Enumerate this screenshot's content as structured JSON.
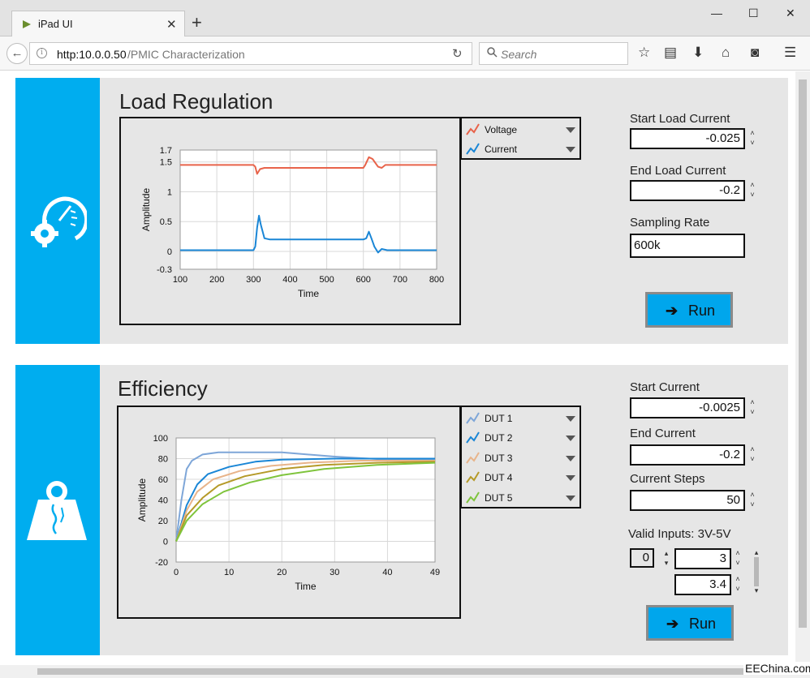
{
  "browser": {
    "tab_title": "iPad UI",
    "tab_close": "✕",
    "new_tab": "+",
    "url_host": "http:10.0.0.50",
    "url_path": "/PMIC Characterization",
    "search_placeholder": "Search"
  },
  "load_regulation": {
    "title": "Load Regulation",
    "chart_data": {
      "type": "line",
      "xlabel": "Time",
      "ylabel": "Amplitude",
      "xlim": [
        100,
        800
      ],
      "ylim": [
        -0.3,
        1.7
      ],
      "x_ticks": [
        "100",
        "200",
        "300",
        "400",
        "500",
        "600",
        "700",
        "800"
      ],
      "y_ticks": [
        "1.7",
        "1.5",
        "1",
        "0.5",
        "0",
        "-0.3"
      ],
      "grid": true,
      "series": [
        {
          "name": "Voltage",
          "color": "#e8634a",
          "points": [
            [
              100,
              1.45
            ],
            [
              300,
              1.45
            ],
            [
              305,
              1.42
            ],
            [
              310,
              1.3
            ],
            [
              318,
              1.38
            ],
            [
              330,
              1.4
            ],
            [
              450,
              1.4
            ],
            [
              600,
              1.4
            ],
            [
              605,
              1.45
            ],
            [
              615,
              1.58
            ],
            [
              625,
              1.55
            ],
            [
              640,
              1.42
            ],
            [
              650,
              1.4
            ],
            [
              660,
              1.45
            ],
            [
              800,
              1.45
            ]
          ]
        },
        {
          "name": "Current",
          "color": "#1a86d6",
          "points": [
            [
              100,
              0.02
            ],
            [
              300,
              0.02
            ],
            [
              305,
              0.08
            ],
            [
              310,
              0.4
            ],
            [
              315,
              0.6
            ],
            [
              320,
              0.45
            ],
            [
              330,
              0.22
            ],
            [
              345,
              0.2
            ],
            [
              600,
              0.2
            ],
            [
              608,
              0.22
            ],
            [
              615,
              0.33
            ],
            [
              622,
              0.22
            ],
            [
              630,
              0.08
            ],
            [
              640,
              -0.02
            ],
            [
              650,
              0.04
            ],
            [
              665,
              0.02
            ],
            [
              800,
              0.02
            ]
          ]
        }
      ]
    },
    "legend": [
      {
        "label": "Voltage",
        "color": "#e8634a"
      },
      {
        "label": "Current",
        "color": "#1a86d6"
      }
    ],
    "controls": {
      "start_label": "Start Load Current",
      "start_value": "-0.025",
      "end_label": "End Load Current",
      "end_value": "-0.2",
      "rate_label": "Sampling Rate",
      "rate_value": "600k",
      "run_label": "Run"
    }
  },
  "efficiency": {
    "title": "Efficiency",
    "chart_data": {
      "type": "line",
      "xlabel": "Time",
      "ylabel": "Amplitude",
      "xlim": [
        0,
        49
      ],
      "ylim": [
        -20,
        100
      ],
      "x_ticks": [
        "0",
        "10",
        "20",
        "30",
        "40",
        "49"
      ],
      "y_ticks": [
        "100",
        "80",
        "60",
        "40",
        "20",
        "0",
        "-20"
      ],
      "grid": true,
      "series": [
        {
          "name": "DUT 1",
          "color": "#7ea6d8",
          "points": [
            [
              0,
              0
            ],
            [
              1,
              40
            ],
            [
              2,
              70
            ],
            [
              3,
              78
            ],
            [
              5,
              84
            ],
            [
              8,
              86
            ],
            [
              12,
              86
            ],
            [
              20,
              86
            ],
            [
              30,
              82
            ],
            [
              40,
              79
            ],
            [
              49,
              79
            ]
          ]
        },
        {
          "name": "DUT 2",
          "color": "#1a86d6",
          "points": [
            [
              0,
              0
            ],
            [
              2,
              35
            ],
            [
              4,
              55
            ],
            [
              6,
              65
            ],
            [
              10,
              72
            ],
            [
              15,
              77
            ],
            [
              20,
              79
            ],
            [
              30,
              80
            ],
            [
              40,
              80
            ],
            [
              49,
              80
            ]
          ]
        },
        {
          "name": "DUT 3",
          "color": "#e8b48a",
          "points": [
            [
              0,
              0
            ],
            [
              2,
              30
            ],
            [
              4,
              48
            ],
            [
              7,
              60
            ],
            [
              12,
              68
            ],
            [
              18,
              73
            ],
            [
              25,
              76
            ],
            [
              35,
              78
            ],
            [
              49,
              78
            ]
          ]
        },
        {
          "name": "DUT 4",
          "color": "#b59a28",
          "points": [
            [
              0,
              0
            ],
            [
              2,
              25
            ],
            [
              5,
              42
            ],
            [
              8,
              54
            ],
            [
              13,
              63
            ],
            [
              20,
              70
            ],
            [
              28,
              74
            ],
            [
              38,
              76
            ],
            [
              49,
              77
            ]
          ]
        },
        {
          "name": "DUT 5",
          "color": "#7fc43c",
          "points": [
            [
              0,
              0
            ],
            [
              2,
              20
            ],
            [
              5,
              36
            ],
            [
              9,
              48
            ],
            [
              14,
              57
            ],
            [
              20,
              64
            ],
            [
              28,
              70
            ],
            [
              38,
              74
            ],
            [
              49,
              76
            ]
          ]
        }
      ]
    },
    "legend": [
      {
        "label": "DUT 1",
        "color": "#7ea6d8"
      },
      {
        "label": "DUT 2",
        "color": "#1a86d6"
      },
      {
        "label": "DUT 3",
        "color": "#e8b48a"
      },
      {
        "label": "DUT 4",
        "color": "#b59a28"
      },
      {
        "label": "DUT 5",
        "color": "#7fc43c"
      }
    ],
    "controls": {
      "start_label": "Start Current",
      "start_value": "-0.0025",
      "end_label": "End Current",
      "end_value": "-0.2",
      "steps_label": "Current Steps",
      "steps_value": "50",
      "valid_label": "Valid Inputs: 3V-5V",
      "index_value": "0",
      "input_1": "3",
      "input_2": "3.4",
      "run_label": "Run"
    }
  },
  "watermark": "EEChina.com"
}
